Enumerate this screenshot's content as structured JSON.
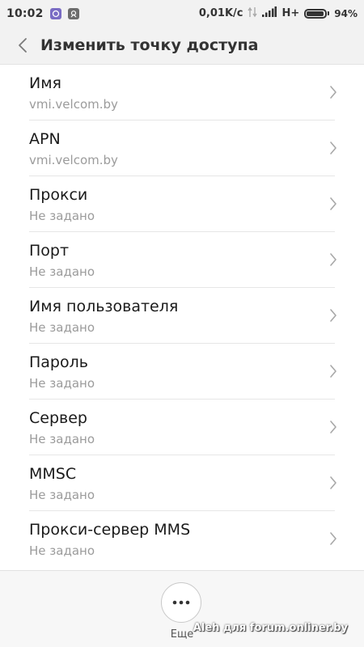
{
  "status_bar": {
    "time": "10:02",
    "speed": "0,01K/c",
    "network": "H+",
    "battery_text": "94%",
    "battery_level": 0.94,
    "icons": [
      "viber-icon",
      "notification-icon",
      "data-arrows-icon",
      "signal-icon",
      "battery-icon"
    ]
  },
  "header": {
    "title": "Изменить точку доступа",
    "back_icon": "chevron-left-icon"
  },
  "list": {
    "items": [
      {
        "title": "Имя",
        "value": "vmi.velcom.by"
      },
      {
        "title": "APN",
        "value": "vmi.velcom.by"
      },
      {
        "title": "Прокси",
        "value": "Не задано"
      },
      {
        "title": "Порт",
        "value": "Не задано"
      },
      {
        "title": "Имя пользователя",
        "value": "Не задано"
      },
      {
        "title": "Пароль",
        "value": "Не задано"
      },
      {
        "title": "Сервер",
        "value": "Не задано"
      },
      {
        "title": "MMSC",
        "value": "Не задано"
      },
      {
        "title": "Прокси-сервер MMS",
        "value": "Не задано"
      }
    ]
  },
  "bottom_bar": {
    "more_label": "Еще",
    "more_icon": "more-dots-icon"
  },
  "watermark": "Aleh для forum.onliner.by",
  "colors": {
    "header_bg": "#f2f2f2",
    "secondary_text": "#9b9b9b",
    "divider": "#e6e6e6"
  }
}
